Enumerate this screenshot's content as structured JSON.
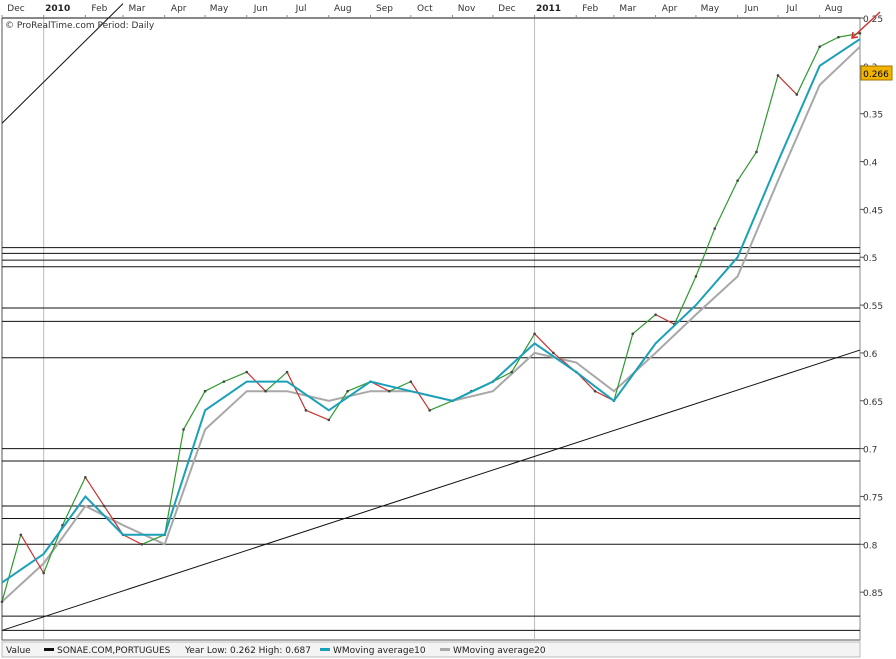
{
  "credit": "© ProRealTime.com Period: Daily",
  "chart_data": {
    "type": "line",
    "title": "",
    "y_axis_inverted": true,
    "ylim": [
      0.25,
      0.9
    ],
    "y_ticks": [
      "0.25",
      "0.3",
      "0.35",
      "0.4",
      "0.45",
      "0.5",
      "0.55",
      "0.6",
      "0.65",
      "0.7",
      "0.75",
      "0.8",
      "0.85"
    ],
    "y_tick_values": [
      0.25,
      0.3,
      0.35,
      0.4,
      0.45,
      0.5,
      0.55,
      0.6,
      0.65,
      0.7,
      0.75,
      0.8,
      0.85
    ],
    "last_value_label": "0.266",
    "x_months": [
      "Dec",
      "2010",
      "Feb",
      "Mar",
      "Apr",
      "May",
      "Jun",
      "Jul",
      "Aug",
      "Sep",
      "Oct",
      "Nov",
      "Dec",
      "2011",
      "Feb",
      "Mar",
      "Apr",
      "May",
      "Jun",
      "Jul",
      "Aug"
    ],
    "x_year_labels": [
      "2010",
      "2011"
    ],
    "x_range": [
      "2009-12-01",
      "2011-08-31"
    ],
    "legend": [
      {
        "label": "Value",
        "color": "#000000"
      },
      {
        "label": "SONAE.COM,PORTUGUES",
        "color": "#111111",
        "note": "Year Low: 0.262 High: 0.687"
      },
      {
        "label": "WMoving average10",
        "color": "#1aa0b8"
      },
      {
        "label": "WMoving average20",
        "color": "#a8a8a8"
      }
    ],
    "horizontal_levels": [
      0.25,
      0.49,
      0.496,
      0.503,
      0.51,
      0.553,
      0.567,
      0.605,
      0.7,
      0.713,
      0.76,
      0.773,
      0.8,
      0.875,
      0.89
    ],
    "trendlines": [
      {
        "x": [
          "2009-12-01",
          "2011-08-31"
        ],
        "y": [
          0.89,
          0.597
        ]
      },
      {
        "x": [
          "2009-12-01",
          "2010-03-01"
        ],
        "y": [
          0.36,
          0.235
        ]
      }
    ],
    "series": [
      {
        "name": "SONAE.COM,PORTUGUES",
        "x": [
          "2009-12-01",
          "2009-12-15",
          "2010-01-01",
          "2010-01-15",
          "2010-02-01",
          "2010-02-15",
          "2010-03-01",
          "2010-03-15",
          "2010-04-01",
          "2010-04-15",
          "2010-05-01",
          "2010-05-15",
          "2010-06-01",
          "2010-06-15",
          "2010-07-01",
          "2010-07-15",
          "2010-08-01",
          "2010-08-15",
          "2010-09-01",
          "2010-09-15",
          "2010-10-01",
          "2010-10-15",
          "2010-11-01",
          "2010-11-15",
          "2010-12-01",
          "2010-12-15",
          "2011-01-01",
          "2011-01-15",
          "2011-02-01",
          "2011-02-15",
          "2011-03-01",
          "2011-03-15",
          "2011-04-01",
          "2011-04-15",
          "2011-05-01",
          "2011-05-15",
          "2011-06-01",
          "2011-06-15",
          "2011-07-01",
          "2011-07-15",
          "2011-08-01",
          "2011-08-15",
          "2011-08-31"
        ],
        "values": [
          0.86,
          0.79,
          0.83,
          0.78,
          0.73,
          0.76,
          0.79,
          0.8,
          0.79,
          0.68,
          0.64,
          0.63,
          0.62,
          0.64,
          0.62,
          0.66,
          0.67,
          0.64,
          0.63,
          0.64,
          0.63,
          0.66,
          0.65,
          0.64,
          0.63,
          0.62,
          0.58,
          0.6,
          0.62,
          0.64,
          0.65,
          0.58,
          0.56,
          0.57,
          0.52,
          0.47,
          0.42,
          0.39,
          0.31,
          0.33,
          0.28,
          0.27,
          0.266
        ]
      },
      {
        "name": "WMoving average10",
        "x": [
          "2009-12-01",
          "2010-01-01",
          "2010-02-01",
          "2010-03-01",
          "2010-04-01",
          "2010-05-01",
          "2010-06-01",
          "2010-07-01",
          "2010-08-01",
          "2010-09-01",
          "2010-10-01",
          "2010-11-01",
          "2010-12-01",
          "2011-01-01",
          "2011-02-01",
          "2011-03-01",
          "2011-04-01",
          "2011-05-01",
          "2011-06-01",
          "2011-07-01",
          "2011-08-01",
          "2011-08-31"
        ],
        "values": [
          0.84,
          0.81,
          0.75,
          0.79,
          0.79,
          0.66,
          0.63,
          0.63,
          0.66,
          0.63,
          0.64,
          0.65,
          0.63,
          0.59,
          0.62,
          0.65,
          0.59,
          0.55,
          0.5,
          0.4,
          0.3,
          0.272
        ]
      },
      {
        "name": "WMoving average20",
        "x": [
          "2009-12-01",
          "2010-01-01",
          "2010-02-01",
          "2010-03-01",
          "2010-04-01",
          "2010-05-01",
          "2010-06-01",
          "2010-07-01",
          "2010-08-01",
          "2010-09-01",
          "2010-10-01",
          "2010-11-01",
          "2010-12-01",
          "2011-01-01",
          "2011-02-01",
          "2011-03-01",
          "2011-04-01",
          "2011-05-01",
          "2011-06-01",
          "2011-07-01",
          "2011-08-01",
          "2011-08-31"
        ],
        "values": [
          0.86,
          0.82,
          0.76,
          0.78,
          0.8,
          0.68,
          0.64,
          0.64,
          0.65,
          0.64,
          0.64,
          0.65,
          0.64,
          0.6,
          0.61,
          0.64,
          0.6,
          0.56,
          0.52,
          0.42,
          0.32,
          0.28
        ]
      }
    ],
    "grid": true
  }
}
